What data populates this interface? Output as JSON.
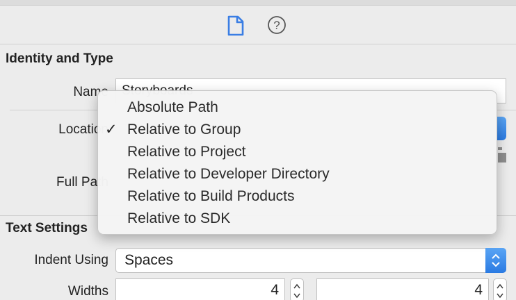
{
  "toolbar": {
    "file_icon": "file-inspector-icon",
    "help_icon": "quick-help-icon",
    "accent": "#3a7ee4"
  },
  "identity": {
    "title": "Identity and Type",
    "name_label": "Name",
    "name_value": "Storyboards",
    "location_label": "Location",
    "full_path_label": "Full Path"
  },
  "location_menu": {
    "selected": "Relative to Group",
    "items": [
      {
        "label": "Absolute Path",
        "checked": false
      },
      {
        "label": "Relative to Group",
        "checked": true
      },
      {
        "label": "Relative to Project",
        "checked": false
      },
      {
        "label": "Relative to Developer Directory",
        "checked": false
      },
      {
        "label": "Relative to Build Products",
        "checked": false
      },
      {
        "label": "Relative to SDK",
        "checked": false
      }
    ],
    "check_glyph": "✓"
  },
  "text_settings": {
    "title": "Text Settings",
    "indent_label": "Indent Using",
    "indent_value": "Spaces",
    "widths_label": "Widths",
    "tab_width": "4",
    "indent_width": "4"
  }
}
